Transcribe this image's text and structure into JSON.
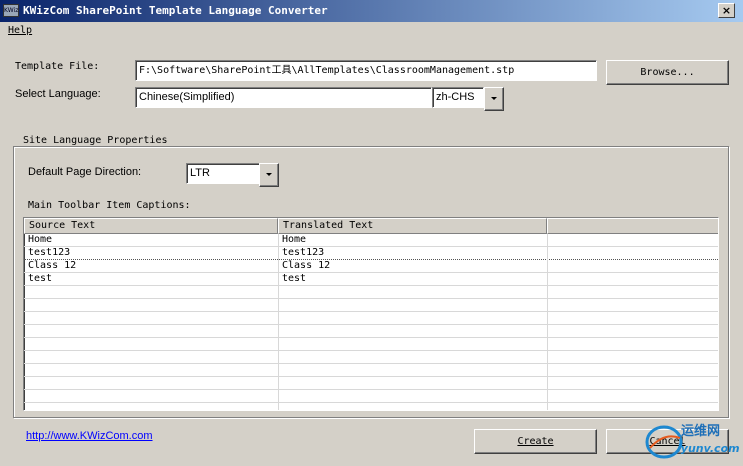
{
  "window": {
    "title": "KWizCom SharePoint Template Language Converter",
    "icon_text": "KWiz",
    "close_symbol": "×"
  },
  "menu": {
    "items": [
      "Help"
    ]
  },
  "template_file": {
    "label": "Template File:",
    "value": "F:\\Software\\SharePoint工具\\AllTemplates\\ClassroomManagement.stp",
    "browse_label": "Browse..."
  },
  "language": {
    "label": "Select Language:",
    "value": "Chinese(Simplified)",
    "code": "zh-CHS"
  },
  "site_props": {
    "legend": "Site Language Properties",
    "direction_label": "Default Page Direction:",
    "direction_value": "LTR",
    "toolbar_label": "Main Toolbar Item Captions:"
  },
  "grid": {
    "columns": [
      "Source Text",
      "Translated Text",
      ""
    ],
    "rows": [
      [
        "Home",
        "Home"
      ],
      [
        "test123",
        "test123"
      ],
      [
        "Class 12",
        "Class 12"
      ],
      [
        "test",
        "test"
      ]
    ],
    "empty_rows": 10
  },
  "footer": {
    "link": "http://www.KWizCom.com",
    "create_label": "Create",
    "cancel_label": "Cancel"
  },
  "watermark": {
    "line1": "运维网",
    "line2": "iyunv.com"
  },
  "colors": {
    "titlebar_start": "#0a246a",
    "titlebar_end": "#a6caf0",
    "face": "#d4d0c8",
    "link": "#0000ff"
  }
}
